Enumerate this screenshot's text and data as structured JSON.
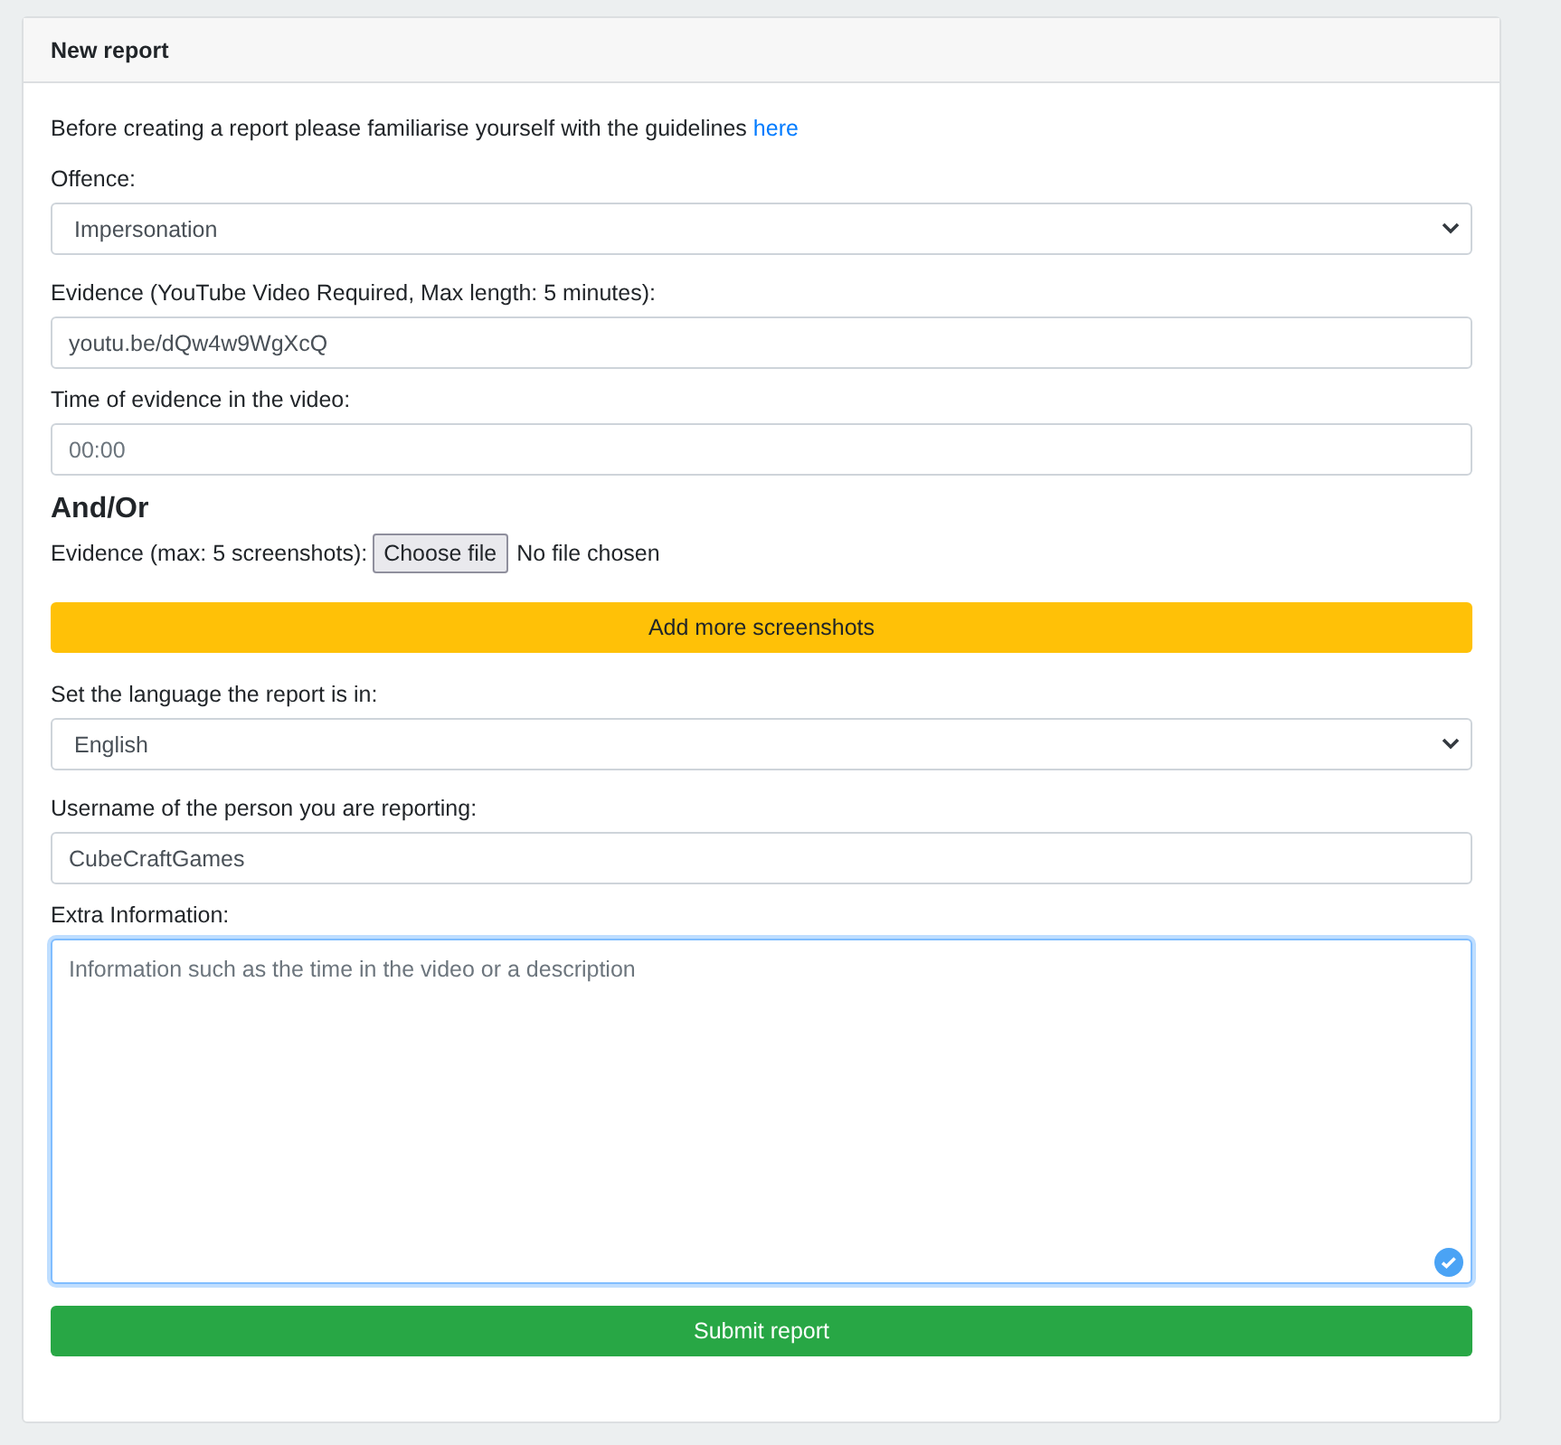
{
  "card": {
    "title": "New report"
  },
  "intro": {
    "text": "Before creating a report please familiarise yourself with the guidelines",
    "link": "here"
  },
  "items": [
    {
      "kind": "select",
      "label": "Offence:",
      "value": "Impersonation"
    },
    {
      "kind": "input",
      "label": "Evidence (YouTube Video Required, Max length: 5 minutes):",
      "value": "youtu.be/dQw4w9WgXcQ"
    },
    {
      "kind": "input",
      "label": "Time of evidence in the video:",
      "placeholder": "00:00"
    },
    {
      "kind": "heading",
      "text": "And/Or"
    },
    {
      "kind": "file",
      "label": "Evidence (max: 5 screenshots):",
      "button": "Choose file",
      "status": "No file chosen"
    },
    {
      "kind": "button",
      "text": "Add more screenshots"
    },
    {
      "kind": "select",
      "label": "Set the language the report is in:",
      "value": "English"
    },
    {
      "kind": "input",
      "label": "Username of the person you are reporting:",
      "value": "CubeCraftGames"
    },
    {
      "kind": "textarea",
      "label": "Extra Information:",
      "placeholder": "Information such as the time in the video or a description",
      "focused": true
    },
    {
      "kind": "submit",
      "text": "Submit report"
    }
  ]
}
